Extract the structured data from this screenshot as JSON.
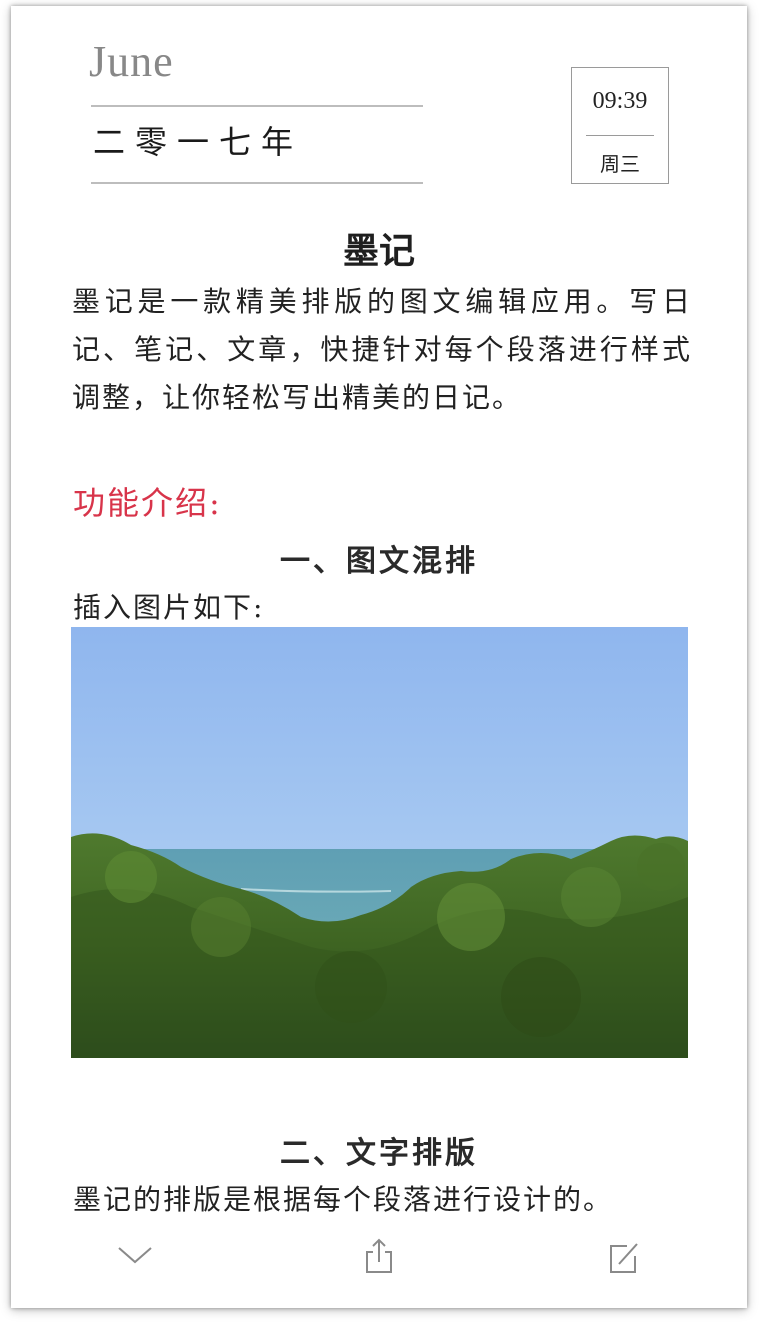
{
  "header": {
    "month": "June",
    "year": "二零一七年",
    "time": "09:39",
    "weekday": "周三"
  },
  "article": {
    "title": "墨记",
    "intro": "墨记是一款精美排版的图文编辑应用。写日记、笔记、文章，快捷针对每个段落进行样式调整，让你轻松写出精美的日记。",
    "feature_heading": "功能介绍:",
    "section1_title": "一、图文混排",
    "insert_note": "插入图片如下:",
    "section2_title": "二、文字排版",
    "layout_note": "墨记的排版是根据每个段落进行设计的。"
  },
  "toolbar": {
    "icons": [
      "chevron-down-icon",
      "share-icon",
      "edit-icon"
    ]
  },
  "colors": {
    "accent": "#d8344a",
    "text": "#222222",
    "muted": "#888888"
  }
}
